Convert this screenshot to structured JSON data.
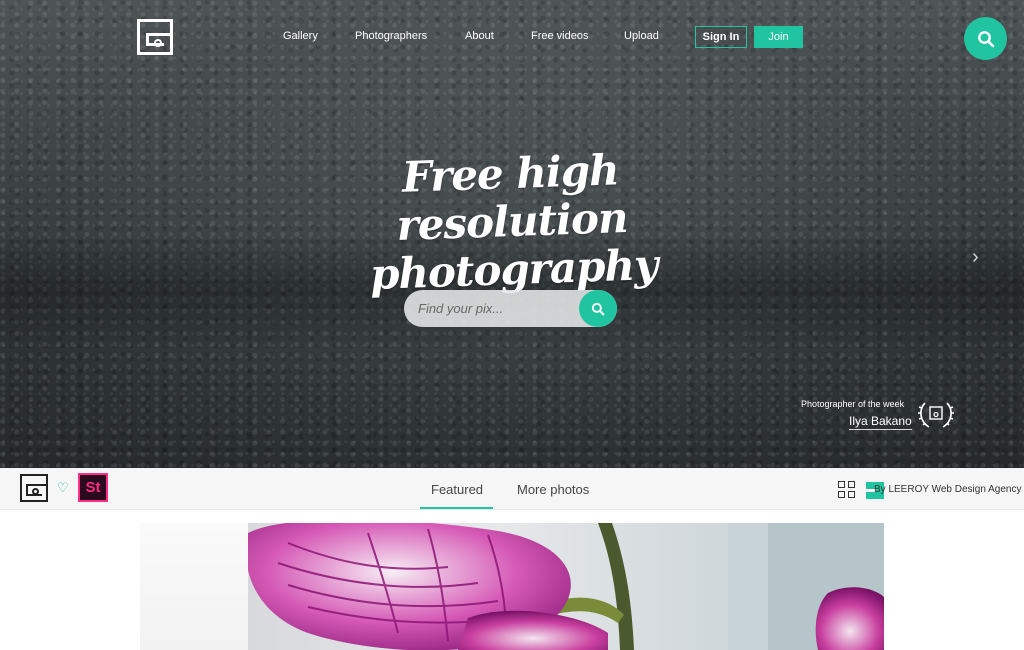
{
  "nav": {
    "items": [
      "Gallery",
      "Photographers",
      "About",
      "Free videos",
      "Upload"
    ],
    "signin_label": "Sign In",
    "join_label": "Join",
    "search_icon": "search-icon"
  },
  "hero": {
    "headline_line1": "Free high resolution",
    "headline_line2": "photography",
    "search_placeholder": "Find your pix...",
    "next_arrow": "›"
  },
  "photographer_of_week": {
    "label": "Photographer of the week",
    "name": "Ilya Bakano"
  },
  "subbar": {
    "st_label": "St",
    "tabs": [
      "Featured",
      "More photos"
    ],
    "active_tab": "Featured",
    "agency_text": "By LEEROY Web Design Agency"
  },
  "colors": {
    "accent": "#21c4a0",
    "adobe_stock": "#ff2d83"
  }
}
